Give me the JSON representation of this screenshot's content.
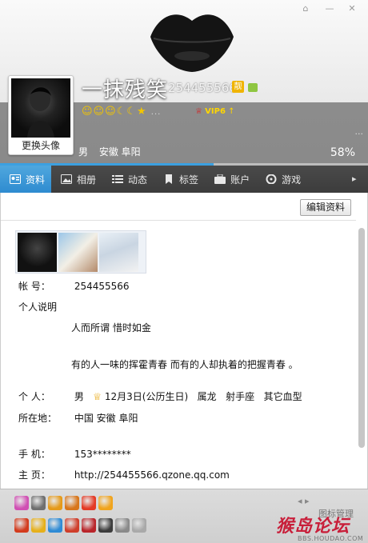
{
  "window": {
    "controls": [
      "⌂",
      "—",
      "✕"
    ]
  },
  "header": {
    "nickname": "一抹残笑",
    "qq_number": "254455566",
    "liang": "靓",
    "level_icons": "☺☺☺☾☾★",
    "level_dots": "...",
    "vip_label": "VIP6",
    "change_avatar": "更换头像",
    "more": "...",
    "gender": "男",
    "location": "安徽 阜阳",
    "completion_percent": "58%",
    "completion_value": 58
  },
  "tabs": [
    {
      "label": "资料",
      "icon": "profile-card-icon",
      "active": true
    },
    {
      "label": "相册",
      "icon": "album-icon",
      "active": false
    },
    {
      "label": "动态",
      "icon": "feed-icon",
      "active": false
    },
    {
      "label": "标签",
      "icon": "tag-icon",
      "active": false
    },
    {
      "label": "账户",
      "icon": "wallet-icon",
      "active": false
    },
    {
      "label": "游戏",
      "icon": "game-icon",
      "active": false
    }
  ],
  "tabs_more": "▸",
  "content": {
    "edit_button": "编辑资料",
    "account_label": "帐 号：",
    "account_value": "254455566",
    "bio_label": "个人说明",
    "bio_line1": "人而所谓  惜时如金",
    "bio_line2": "有的人一味的挥霍青春  而有的人却执着的把握青春 。",
    "personal_label": "个 人：",
    "personal_gender": "男",
    "personal_birthday": "12月3日(公历生日)",
    "personal_zodiac": "属龙",
    "personal_sign": "射手座",
    "personal_blood": "其它血型",
    "location_label": "所在地：",
    "location_value": "中国 安徽 阜阳",
    "phone_label": "手 机：",
    "phone_value": "153********",
    "homepage_label": "主 页：",
    "homepage_value": "http://254455566.qzone.qq.com"
  },
  "bottom": {
    "nav": "◂ ▸",
    "manage": "图标管理",
    "watermark": "猴岛论坛",
    "watermark_sub": "BBS.HOUDAO.COM",
    "badges_row1": [
      "#d04fb3",
      "#6f6f6f",
      "#e59a19",
      "#d8761b",
      "#e43a25",
      "#f0a41d"
    ],
    "badges_row2": [
      "#d33b1d",
      "#e6b01a",
      "#2e8bd5",
      "#cf3e2a",
      "#b9252a",
      "#3c3c3c",
      "#8a8a8a",
      "#a9a9a9"
    ]
  },
  "colors": {
    "accent": "#2e8bd0",
    "tab_bar": "#434343",
    "header_gray": "#8a8a8a",
    "progress": "#3ba0e0"
  }
}
